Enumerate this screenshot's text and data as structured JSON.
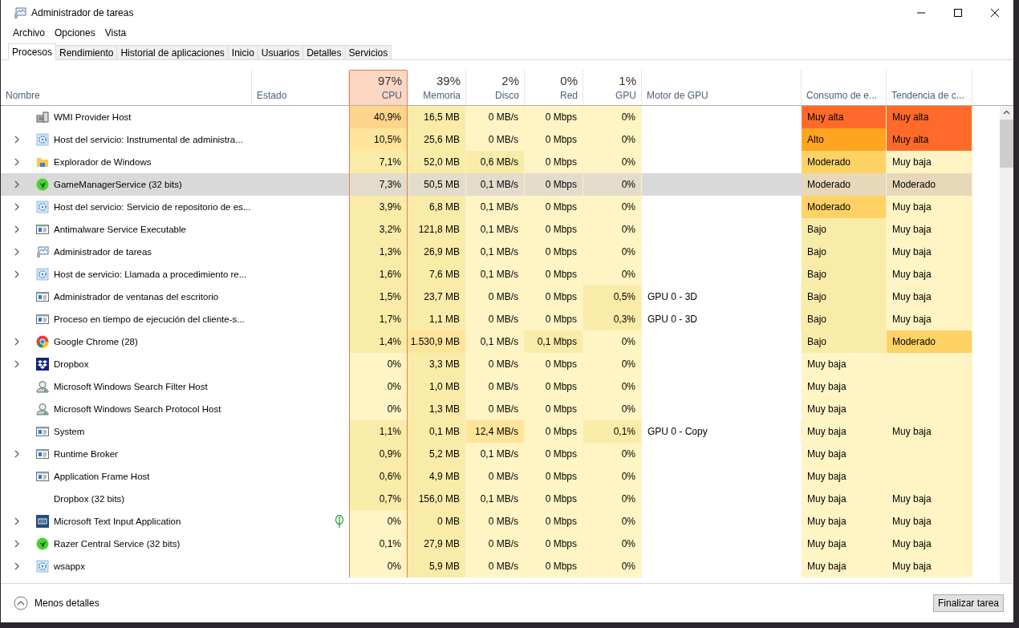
{
  "window": {
    "title": "Administrador de tareas"
  },
  "menu": [
    "Archivo",
    "Opciones",
    "Vista"
  ],
  "tabs": [
    {
      "label": "Procesos",
      "selected": true
    },
    {
      "label": "Rendimiento",
      "selected": false
    },
    {
      "label": "Historial de aplicaciones",
      "selected": false
    },
    {
      "label": "Inicio",
      "selected": false
    },
    {
      "label": "Usuarios",
      "selected": false
    },
    {
      "label": "Detalles",
      "selected": false
    },
    {
      "label": "Servicios",
      "selected": false
    }
  ],
  "columns": [
    {
      "label": "Nombre",
      "sorted": false
    },
    {
      "label": "Estado",
      "sorted": false
    },
    {
      "label": "CPU",
      "total": "97%",
      "sorted": true
    },
    {
      "label": "Memoria",
      "total": "39%",
      "sorted": false
    },
    {
      "label": "Disco",
      "total": "2%",
      "sorted": false
    },
    {
      "label": "Red",
      "total": "0%",
      "sorted": false
    },
    {
      "label": "GPU",
      "total": "1%",
      "sorted": false
    },
    {
      "label": "Motor de GPU",
      "sorted": false
    },
    {
      "label": "Consumo de e...",
      "sorted": false
    },
    {
      "label": "Tendencia de c...",
      "sorted": false
    }
  ],
  "rows": [
    {
      "name": "WMI Provider Host",
      "kind": "wmi",
      "expandable": false,
      "selected": false,
      "eco": false,
      "cells": [
        {
          "text": "40,9%",
          "color": "#fcd48a"
        },
        {
          "text": "16,5 MB",
          "color": "#f9eca8"
        },
        {
          "text": "0 MB/s",
          "color": "#fff4c4"
        },
        {
          "text": "0 Mbps",
          "color": "#fff4c4"
        },
        {
          "text": "0%",
          "color": "#fff4c4"
        }
      ],
      "energy": {
        "text": "Muy alta",
        "color": "#ff6a2b"
      },
      "trend": {
        "text": "Muy alta",
        "color": "#ff6a2b"
      }
    },
    {
      "name": "Host del servicio: Instrumental de administra...",
      "kind": "gear",
      "expandable": true,
      "selected": false,
      "eco": false,
      "cells": [
        {
          "text": "10,5%",
          "color": "#ffe49a"
        },
        {
          "text": "25,6 MB",
          "color": "#f9eca8"
        },
        {
          "text": "0 MB/s",
          "color": "#fff4c4"
        },
        {
          "text": "0 Mbps",
          "color": "#fff4c4"
        },
        {
          "text": "0%",
          "color": "#fff4c4"
        }
      ],
      "energy": {
        "text": "Alto",
        "color": "#ffa41f"
      },
      "trend": {
        "text": "Muy alta",
        "color": "#ff6a2b"
      }
    },
    {
      "name": "Explorador de Windows",
      "kind": "folder",
      "expandable": true,
      "selected": false,
      "eco": false,
      "cells": [
        {
          "text": "7,1%",
          "color": "#f9eca8"
        },
        {
          "text": "52,0 MB",
          "color": "#f9eca8"
        },
        {
          "text": "0,6 MB/s",
          "color": "#f9eca8"
        },
        {
          "text": "0 Mbps",
          "color": "#fff4c4"
        },
        {
          "text": "0%",
          "color": "#fff4c4"
        }
      ],
      "energy": {
        "text": "Moderado",
        "color": "#ffd266"
      },
      "trend": {
        "text": "Muy baja",
        "color": "#fff4c4"
      }
    },
    {
      "name": "GameManagerService (32 bits)",
      "kind": "razer",
      "expandable": true,
      "selected": true,
      "eco": false,
      "cells": [
        {
          "text": "7,3%",
          "color": "#e3dccb"
        },
        {
          "text": "50,5 MB",
          "color": "#e3dccb"
        },
        {
          "text": "0,1 MB/s",
          "color": "#e3dccb"
        },
        {
          "text": "0 Mbps",
          "color": "#e3dccb"
        },
        {
          "text": "0%",
          "color": "#e3dccb"
        }
      ],
      "energy": {
        "text": "Moderado",
        "color": "#e6d8b8"
      },
      "trend": {
        "text": "Moderado",
        "color": "#e6d8b8"
      }
    },
    {
      "name": "Host del servicio: Servicio de repositorio de es...",
      "kind": "gear",
      "expandable": true,
      "selected": false,
      "eco": false,
      "cells": [
        {
          "text": "3,9%",
          "color": "#f9eca8"
        },
        {
          "text": "6,8 MB",
          "color": "#f9eca8"
        },
        {
          "text": "0,1 MB/s",
          "color": "#fff4c4"
        },
        {
          "text": "0 Mbps",
          "color": "#fff4c4"
        },
        {
          "text": "0%",
          "color": "#fff4c4"
        }
      ],
      "energy": {
        "text": "Moderado",
        "color": "#ffd266"
      },
      "trend": {
        "text": "Muy baja",
        "color": "#fff4c4"
      }
    },
    {
      "name": "Antimalware Service Executable",
      "kind": "window",
      "expandable": true,
      "selected": false,
      "eco": false,
      "cells": [
        {
          "text": "3,2%",
          "color": "#f9eca8"
        },
        {
          "text": "121,8 MB",
          "color": "#f9eca8"
        },
        {
          "text": "0,1 MB/s",
          "color": "#fff4c4"
        },
        {
          "text": "0 Mbps",
          "color": "#fff4c4"
        },
        {
          "text": "0%",
          "color": "#fff4c4"
        }
      ],
      "energy": {
        "text": "Bajo",
        "color": "#f9eca8"
      },
      "trend": {
        "text": "Muy baja",
        "color": "#fff4c4"
      }
    },
    {
      "name": "Administrador de tareas",
      "kind": "monitor",
      "expandable": true,
      "selected": false,
      "eco": false,
      "cells": [
        {
          "text": "1,3%",
          "color": "#f9eca8"
        },
        {
          "text": "26,9 MB",
          "color": "#f9eca8"
        },
        {
          "text": "0,1 MB/s",
          "color": "#fff4c4"
        },
        {
          "text": "0 Mbps",
          "color": "#fff4c4"
        },
        {
          "text": "0%",
          "color": "#fff4c4"
        }
      ],
      "energy": {
        "text": "Bajo",
        "color": "#f9eca8"
      },
      "trend": {
        "text": "Muy baja",
        "color": "#fff4c4"
      }
    },
    {
      "name": "Host de servicio: Llamada a procedimiento re...",
      "kind": "gear",
      "expandable": true,
      "selected": false,
      "eco": false,
      "cells": [
        {
          "text": "1,6%",
          "color": "#f9eca8"
        },
        {
          "text": "7,6 MB",
          "color": "#f9eca8"
        },
        {
          "text": "0,1 MB/s",
          "color": "#fff4c4"
        },
        {
          "text": "0 Mbps",
          "color": "#fff4c4"
        },
        {
          "text": "0%",
          "color": "#fff4c4"
        }
      ],
      "energy": {
        "text": "Bajo",
        "color": "#f9eca8"
      },
      "trend": {
        "text": "Muy baja",
        "color": "#fff4c4"
      }
    },
    {
      "name": "Administrador de ventanas del escritorio",
      "kind": "window",
      "expandable": false,
      "selected": false,
      "eco": false,
      "gpu_engine": "GPU 0 - 3D",
      "cells": [
        {
          "text": "1,5%",
          "color": "#f9eca8"
        },
        {
          "text": "23,7 MB",
          "color": "#f9eca8"
        },
        {
          "text": "0 MB/s",
          "color": "#fff4c4"
        },
        {
          "text": "0 Mbps",
          "color": "#fff4c4"
        },
        {
          "text": "0,5%",
          "color": "#f9eca8"
        }
      ],
      "energy": {
        "text": "Bajo",
        "color": "#f9eca8"
      },
      "trend": {
        "text": "Muy baja",
        "color": "#fff4c4"
      }
    },
    {
      "name": "Proceso en tiempo de ejecución del cliente-s...",
      "kind": "window",
      "expandable": false,
      "selected": false,
      "eco": false,
      "gpu_engine": "GPU 0 - 3D",
      "cells": [
        {
          "text": "1,7%",
          "color": "#f9eca8"
        },
        {
          "text": "1,1 MB",
          "color": "#f9eca8"
        },
        {
          "text": "0 MB/s",
          "color": "#fff4c4"
        },
        {
          "text": "0 Mbps",
          "color": "#fff4c4"
        },
        {
          "text": "0,3%",
          "color": "#f9eca8"
        }
      ],
      "energy": {
        "text": "Bajo",
        "color": "#f9eca8"
      },
      "trend": {
        "text": "Muy baja",
        "color": "#fff4c4"
      }
    },
    {
      "name": "Google Chrome (28)",
      "kind": "chrome",
      "expandable": true,
      "selected": false,
      "eco": false,
      "cells": [
        {
          "text": "1,4%",
          "color": "#f9eca8"
        },
        {
          "text": "1.530,9 MB",
          "color": "#ffe49a"
        },
        {
          "text": "0,1 MB/s",
          "color": "#fff4c4"
        },
        {
          "text": "0,1 Mbps",
          "color": "#f9eca8"
        },
        {
          "text": "0%",
          "color": "#fff4c4"
        }
      ],
      "energy": {
        "text": "Bajo",
        "color": "#f9eca8"
      },
      "trend": {
        "text": "Moderado",
        "color": "#ffd266"
      }
    },
    {
      "name": "Dropbox",
      "kind": "dropbox",
      "expandable": true,
      "selected": false,
      "eco": false,
      "cells": [
        {
          "text": "0%",
          "color": "#fff4c4"
        },
        {
          "text": "3,3 MB",
          "color": "#f9eca8"
        },
        {
          "text": "0 MB/s",
          "color": "#fff4c4"
        },
        {
          "text": "0 Mbps",
          "color": "#fff4c4"
        },
        {
          "text": "0%",
          "color": "#fff4c4"
        }
      ],
      "energy": {
        "text": "Muy baja",
        "color": "#fff4c4"
      },
      "trend": {
        "color": "#fff4c4"
      }
    },
    {
      "name": "Microsoft Windows Search Filter Host",
      "kind": "search",
      "expandable": false,
      "selected": false,
      "eco": false,
      "cells": [
        {
          "text": "0%",
          "color": "#fff4c4"
        },
        {
          "text": "1,0 MB",
          "color": "#f9eca8"
        },
        {
          "text": "0 MB/s",
          "color": "#fff4c4"
        },
        {
          "text": "0 Mbps",
          "color": "#fff4c4"
        },
        {
          "text": "0%",
          "color": "#fff4c4"
        }
      ],
      "energy": {
        "text": "Muy baja",
        "color": "#fff4c4"
      },
      "trend": {
        "color": "#fff4c4"
      }
    },
    {
      "name": "Microsoft Windows Search Protocol Host",
      "kind": "search",
      "expandable": false,
      "selected": false,
      "eco": false,
      "cells": [
        {
          "text": "0%",
          "color": "#fff4c4"
        },
        {
          "text": "1,3 MB",
          "color": "#f9eca8"
        },
        {
          "text": "0 MB/s",
          "color": "#fff4c4"
        },
        {
          "text": "0 Mbps",
          "color": "#fff4c4"
        },
        {
          "text": "0%",
          "color": "#fff4c4"
        }
      ],
      "energy": {
        "text": "Muy baja",
        "color": "#fff4c4"
      },
      "trend": {
        "color": "#fff4c4"
      }
    },
    {
      "name": "System",
      "kind": "window",
      "expandable": false,
      "selected": false,
      "eco": false,
      "gpu_engine": "GPU 0 - Copy",
      "cells": [
        {
          "text": "1,1%",
          "color": "#f9eca8"
        },
        {
          "text": "0,1 MB",
          "color": "#f9eca8"
        },
        {
          "text": "12,4 MB/s",
          "color": "#ffe49a"
        },
        {
          "text": "0 Mbps",
          "color": "#fff4c4"
        },
        {
          "text": "0,1%",
          "color": "#f9eca8"
        }
      ],
      "energy": {
        "text": "Muy baja",
        "color": "#fff4c4"
      },
      "trend": {
        "text": "Muy baja",
        "color": "#fff4c4"
      }
    },
    {
      "name": "Runtime Broker",
      "kind": "window",
      "expandable": true,
      "selected": false,
      "eco": false,
      "cells": [
        {
          "text": "0,9%",
          "color": "#f9eca8"
        },
        {
          "text": "5,2 MB",
          "color": "#f9eca8"
        },
        {
          "text": "0,1 MB/s",
          "color": "#fff4c4"
        },
        {
          "text": "0 Mbps",
          "color": "#fff4c4"
        },
        {
          "text": "0%",
          "color": "#fff4c4"
        }
      ],
      "energy": {
        "text": "Muy baja",
        "color": "#fff4c4"
      },
      "trend": {
        "color": "#fff4c4"
      }
    },
    {
      "name": "Application Frame Host",
      "kind": "window",
      "expandable": false,
      "selected": false,
      "eco": false,
      "cells": [
        {
          "text": "0,6%",
          "color": "#f9eca8"
        },
        {
          "text": "4,9 MB",
          "color": "#f9eca8"
        },
        {
          "text": "0 MB/s",
          "color": "#fff4c4"
        },
        {
          "text": "0 Mbps",
          "color": "#fff4c4"
        },
        {
          "text": "0%",
          "color": "#fff4c4"
        }
      ],
      "energy": {
        "text": "Muy baja",
        "color": "#fff4c4"
      },
      "trend": {
        "color": "#fff4c4"
      }
    },
    {
      "name": "Dropbox (32 bits)",
      "kind": "blank",
      "expandable": false,
      "selected": false,
      "eco": false,
      "cells": [
        {
          "text": "0,7%",
          "color": "#f9eca8"
        },
        {
          "text": "156,0 MB",
          "color": "#f9eca8"
        },
        {
          "text": "0,1 MB/s",
          "color": "#fff4c4"
        },
        {
          "text": "0 Mbps",
          "color": "#fff4c4"
        },
        {
          "text": "0%",
          "color": "#fff4c4"
        }
      ],
      "energy": {
        "text": "Muy baja",
        "color": "#fff4c4"
      },
      "trend": {
        "text": "Muy baja",
        "color": "#fff4c4"
      }
    },
    {
      "name": "Microsoft Text Input Application",
      "kind": "keyboard",
      "expandable": true,
      "selected": false,
      "eco": true,
      "cells": [
        {
          "text": "0%",
          "color": "#fff4c4"
        },
        {
          "text": "0 MB",
          "color": "#f9eca8"
        },
        {
          "text": "0 MB/s",
          "color": "#fff4c4"
        },
        {
          "text": "0 Mbps",
          "color": "#fff4c4"
        },
        {
          "text": "0%",
          "color": "#fff4c4"
        }
      ],
      "energy": {
        "text": "Muy baja",
        "color": "#fff4c4"
      },
      "trend": {
        "text": "Muy baja",
        "color": "#fff4c4"
      }
    },
    {
      "name": "Razer Central Service (32 bits)",
      "kind": "razer",
      "expandable": true,
      "selected": false,
      "eco": false,
      "cells": [
        {
          "text": "0,1%",
          "color": "#fff4c4"
        },
        {
          "text": "27,9 MB",
          "color": "#f9eca8"
        },
        {
          "text": "0 MB/s",
          "color": "#fff4c4"
        },
        {
          "text": "0 Mbps",
          "color": "#fff4c4"
        },
        {
          "text": "0%",
          "color": "#fff4c4"
        }
      ],
      "energy": {
        "text": "Muy baja",
        "color": "#fff4c4"
      },
      "trend": {
        "text": "Muy baja",
        "color": "#fff4c4"
      }
    },
    {
      "name": "wsappx",
      "kind": "gear",
      "expandable": true,
      "selected": false,
      "eco": false,
      "cells": [
        {
          "text": "0%",
          "color": "#fff4c4"
        },
        {
          "text": "5,9 MB",
          "color": "#f9eca8"
        },
        {
          "text": "0 MB/s",
          "color": "#fff4c4"
        },
        {
          "text": "0 Mbps",
          "color": "#fff4c4"
        },
        {
          "text": "0%",
          "color": "#fff4c4"
        }
      ],
      "energy": {
        "text": "Muy baja",
        "color": "#fff4c4"
      },
      "trend": {
        "text": "Muy baja",
        "color": "#fff4c4"
      }
    }
  ],
  "footer": {
    "toggle": "Menos detalles",
    "button": "Finalizar tarea"
  }
}
